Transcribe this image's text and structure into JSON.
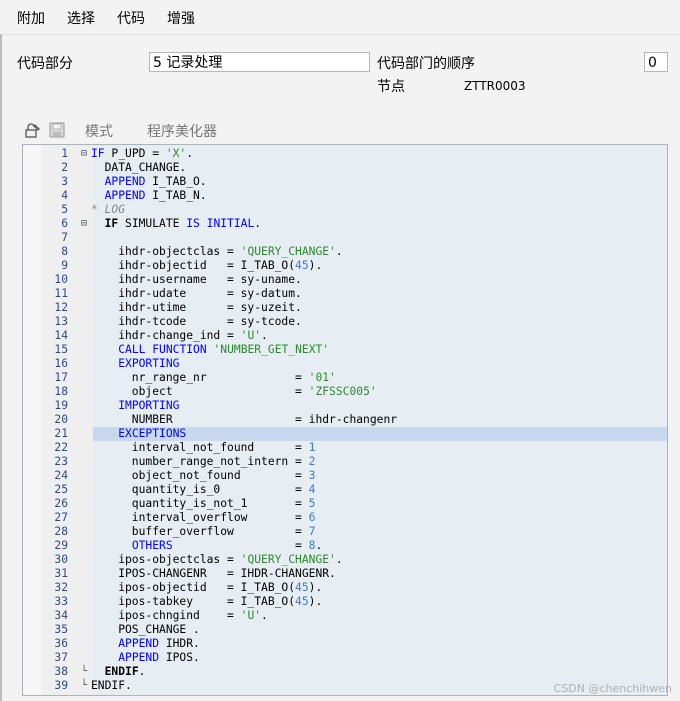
{
  "menu": [
    "附加",
    "选择",
    "代码",
    "增强"
  ],
  "form": {
    "code_part_label": "代码部分",
    "code_part_value": "5 记录处理",
    "order_label": "代码部门的顺序",
    "order_value": "0",
    "node_label": "节点",
    "node_value": "ZTTR0003"
  },
  "toolbar": {
    "mode_label": "模式",
    "beautifier_label": "程序美化器"
  },
  "editor": {
    "highlighted_line": 21,
    "lines": [
      {
        "n": "1",
        "fold": "⊟",
        "code": "<span class='kw'>IF</span> P_UPD = <span class='str'>'X'</span>."
      },
      {
        "n": "2",
        "fold": "",
        "code": "  DATA_CHANGE."
      },
      {
        "n": "3",
        "fold": "",
        "code": "  <span class='kw'>APPEND</span> I_TAB_O."
      },
      {
        "n": "4",
        "fold": "",
        "code": "  <span class='kw'>APPEND</span> I_TAB_N."
      },
      {
        "n": "5",
        "fold": "",
        "code": "<span class='cmt'>* LOG</span>"
      },
      {
        "n": "6",
        "fold": "⊟",
        "code": "  <span class='kwb'>IF</span> SIMULATE <span class='kw'>IS</span> <span class='kw'>INITIAL</span>."
      },
      {
        "n": "7",
        "fold": "",
        "code": ""
      },
      {
        "n": "8",
        "fold": "",
        "code": "    ihdr-objectclas = <span class='str'>'QUERY_CHANGE'</span>."
      },
      {
        "n": "9",
        "fold": "",
        "code": "    ihdr-objectid   = I_TAB_O(<span class='numl'>45</span>)."
      },
      {
        "n": "10",
        "fold": "",
        "code": "    ihdr-username   = sy-uname."
      },
      {
        "n": "11",
        "fold": "",
        "code": "    ihdr-udate      = sy-datum."
      },
      {
        "n": "12",
        "fold": "",
        "code": "    ihdr-utime      = sy-uzeit."
      },
      {
        "n": "13",
        "fold": "",
        "code": "    ihdr-tcode      = sy-tcode."
      },
      {
        "n": "14",
        "fold": "",
        "code": "    ihdr-change_ind = <span class='str'>'U'</span>."
      },
      {
        "n": "15",
        "fold": "",
        "code": "    <span class='kw'>CALL</span> <span class='kw'>FUNCTION</span> <span class='str'>'NUMBER_GET_NEXT'</span>"
      },
      {
        "n": "16",
        "fold": "",
        "code": "    <span class='kw'>EXPORTING</span>"
      },
      {
        "n": "17",
        "fold": "",
        "code": "      nr_range_nr             = <span class='str'>'01'</span>"
      },
      {
        "n": "18",
        "fold": "",
        "code": "      object                  = <span class='str'>'ZFSSC005'</span>"
      },
      {
        "n": "19",
        "fold": "",
        "code": "    <span class='kw'>IMPORTING</span>"
      },
      {
        "n": "20",
        "fold": "",
        "code": "      NUMBER                  = ihdr-changenr"
      },
      {
        "n": "21",
        "fold": "",
        "code": "    <span class='kw'>EXCEPTIONS</span>"
      },
      {
        "n": "22",
        "fold": "",
        "code": "      interval_not_found      = <span class='numl'>1</span>"
      },
      {
        "n": "23",
        "fold": "",
        "code": "      number_range_not_intern = <span class='numl'>2</span>"
      },
      {
        "n": "24",
        "fold": "",
        "code": "      object_not_found        = <span class='numl'>3</span>"
      },
      {
        "n": "25",
        "fold": "",
        "code": "      quantity_is_0           = <span class='numl'>4</span>"
      },
      {
        "n": "26",
        "fold": "",
        "code": "      quantity_is_not_1       = <span class='numl'>5</span>"
      },
      {
        "n": "27",
        "fold": "",
        "code": "      interval_overflow       = <span class='numl'>6</span>"
      },
      {
        "n": "28",
        "fold": "",
        "code": "      buffer_overflow         = <span class='numl'>7</span>"
      },
      {
        "n": "29",
        "fold": "",
        "code": "      <span class='kw'>OTHERS</span>                  = <span class='numl'>8</span>."
      },
      {
        "n": "30",
        "fold": "",
        "code": "    ipos-objectclas = <span class='str'>'QUERY_CHANGE'</span>."
      },
      {
        "n": "31",
        "fold": "",
        "code": "    IPOS-CHANGENR   = IHDR-CHANGENR."
      },
      {
        "n": "32",
        "fold": "",
        "code": "    ipos-objectid   = I_TAB_O(<span class='numl'>45</span>)."
      },
      {
        "n": "33",
        "fold": "",
        "code": "    ipos-tabkey     = I_TAB_O(<span class='numl'>45</span>)."
      },
      {
        "n": "34",
        "fold": "",
        "code": "    ipos-chngind    = <span class='str'>'U'</span>."
      },
      {
        "n": "35",
        "fold": "",
        "code": "    POS_CHANGE ."
      },
      {
        "n": "36",
        "fold": "",
        "code": "    <span class='kw'>APPEND</span> IHDR."
      },
      {
        "n": "37",
        "fold": "",
        "code": "    <span class='kw'>APPEND</span> IPOS."
      },
      {
        "n": "38",
        "fold": "└",
        "code": "  <span class='kwb'>ENDIF</span>."
      },
      {
        "n": "39",
        "fold": "└",
        "code": "ENDIF."
      }
    ]
  },
  "watermark": "CSDN @chenchihwen"
}
